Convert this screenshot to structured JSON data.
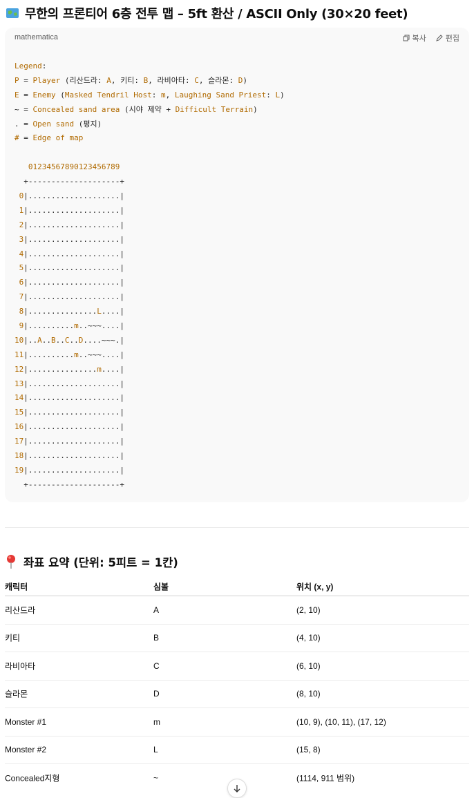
{
  "title": "무한의 프론티어 6층 전투 맵 – 5ft 환산 / ASCII Only (30×20 feet)",
  "code_block": {
    "language": "mathematica",
    "copy_label": "복사",
    "edit_label": "편집",
    "lines": [
      "Legend:",
      "P = Player (리산드라: A, 키티: B, 라비아타: C, 슬라몬: D)",
      "E = Enemy (Masked Tendril Host: m, Laughing Sand Priest: L)",
      "~ = Concealed sand area (시야 제약 + Difficult Terrain)",
      ". = Open sand (평지)",
      "# = Edge of map",
      "",
      "   01234567890123456789",
      "  +--------------------+",
      " 0|....................|",
      " 1|....................|",
      " 2|....................|",
      " 3|....................|",
      " 4|....................|",
      " 5|....................|",
      " 6|....................|",
      " 7|....................|",
      " 8|...............L....|",
      " 9|..........m..~~~....|",
      "10|..A..B..C..D....~~~.|",
      "11|..........m..~~~....|",
      "12|...............m....|",
      "13|....................|",
      "14|....................|",
      "15|....................|",
      "16|....................|",
      "17|....................|",
      "18|....................|",
      "19|....................|",
      "  +--------------------+"
    ]
  },
  "section_title": "좌표 요약 (단위: 5피트 = 1칸)",
  "table": {
    "headers": [
      "캐릭터",
      "심볼",
      "위치 (x, y)"
    ],
    "rows": [
      [
        "리산드라",
        "A",
        "(2, 10)"
      ],
      [
        "키티",
        "B",
        "(4, 10)"
      ],
      [
        "라비아타",
        "C",
        "(6, 10)"
      ],
      [
        "슬라몬",
        "D",
        "(8, 10)"
      ],
      [
        "Monster #1",
        "m",
        "(10, 9), (10, 11), (17, 12)"
      ],
      [
        "Monster #2",
        "L",
        "(15, 8)"
      ],
      [
        "Concealed지형",
        "~",
        "(1114, 911 범위)"
      ]
    ]
  },
  "colors": {
    "accent_code": "#b06a00",
    "code_bg": "#f9f9f9"
  }
}
